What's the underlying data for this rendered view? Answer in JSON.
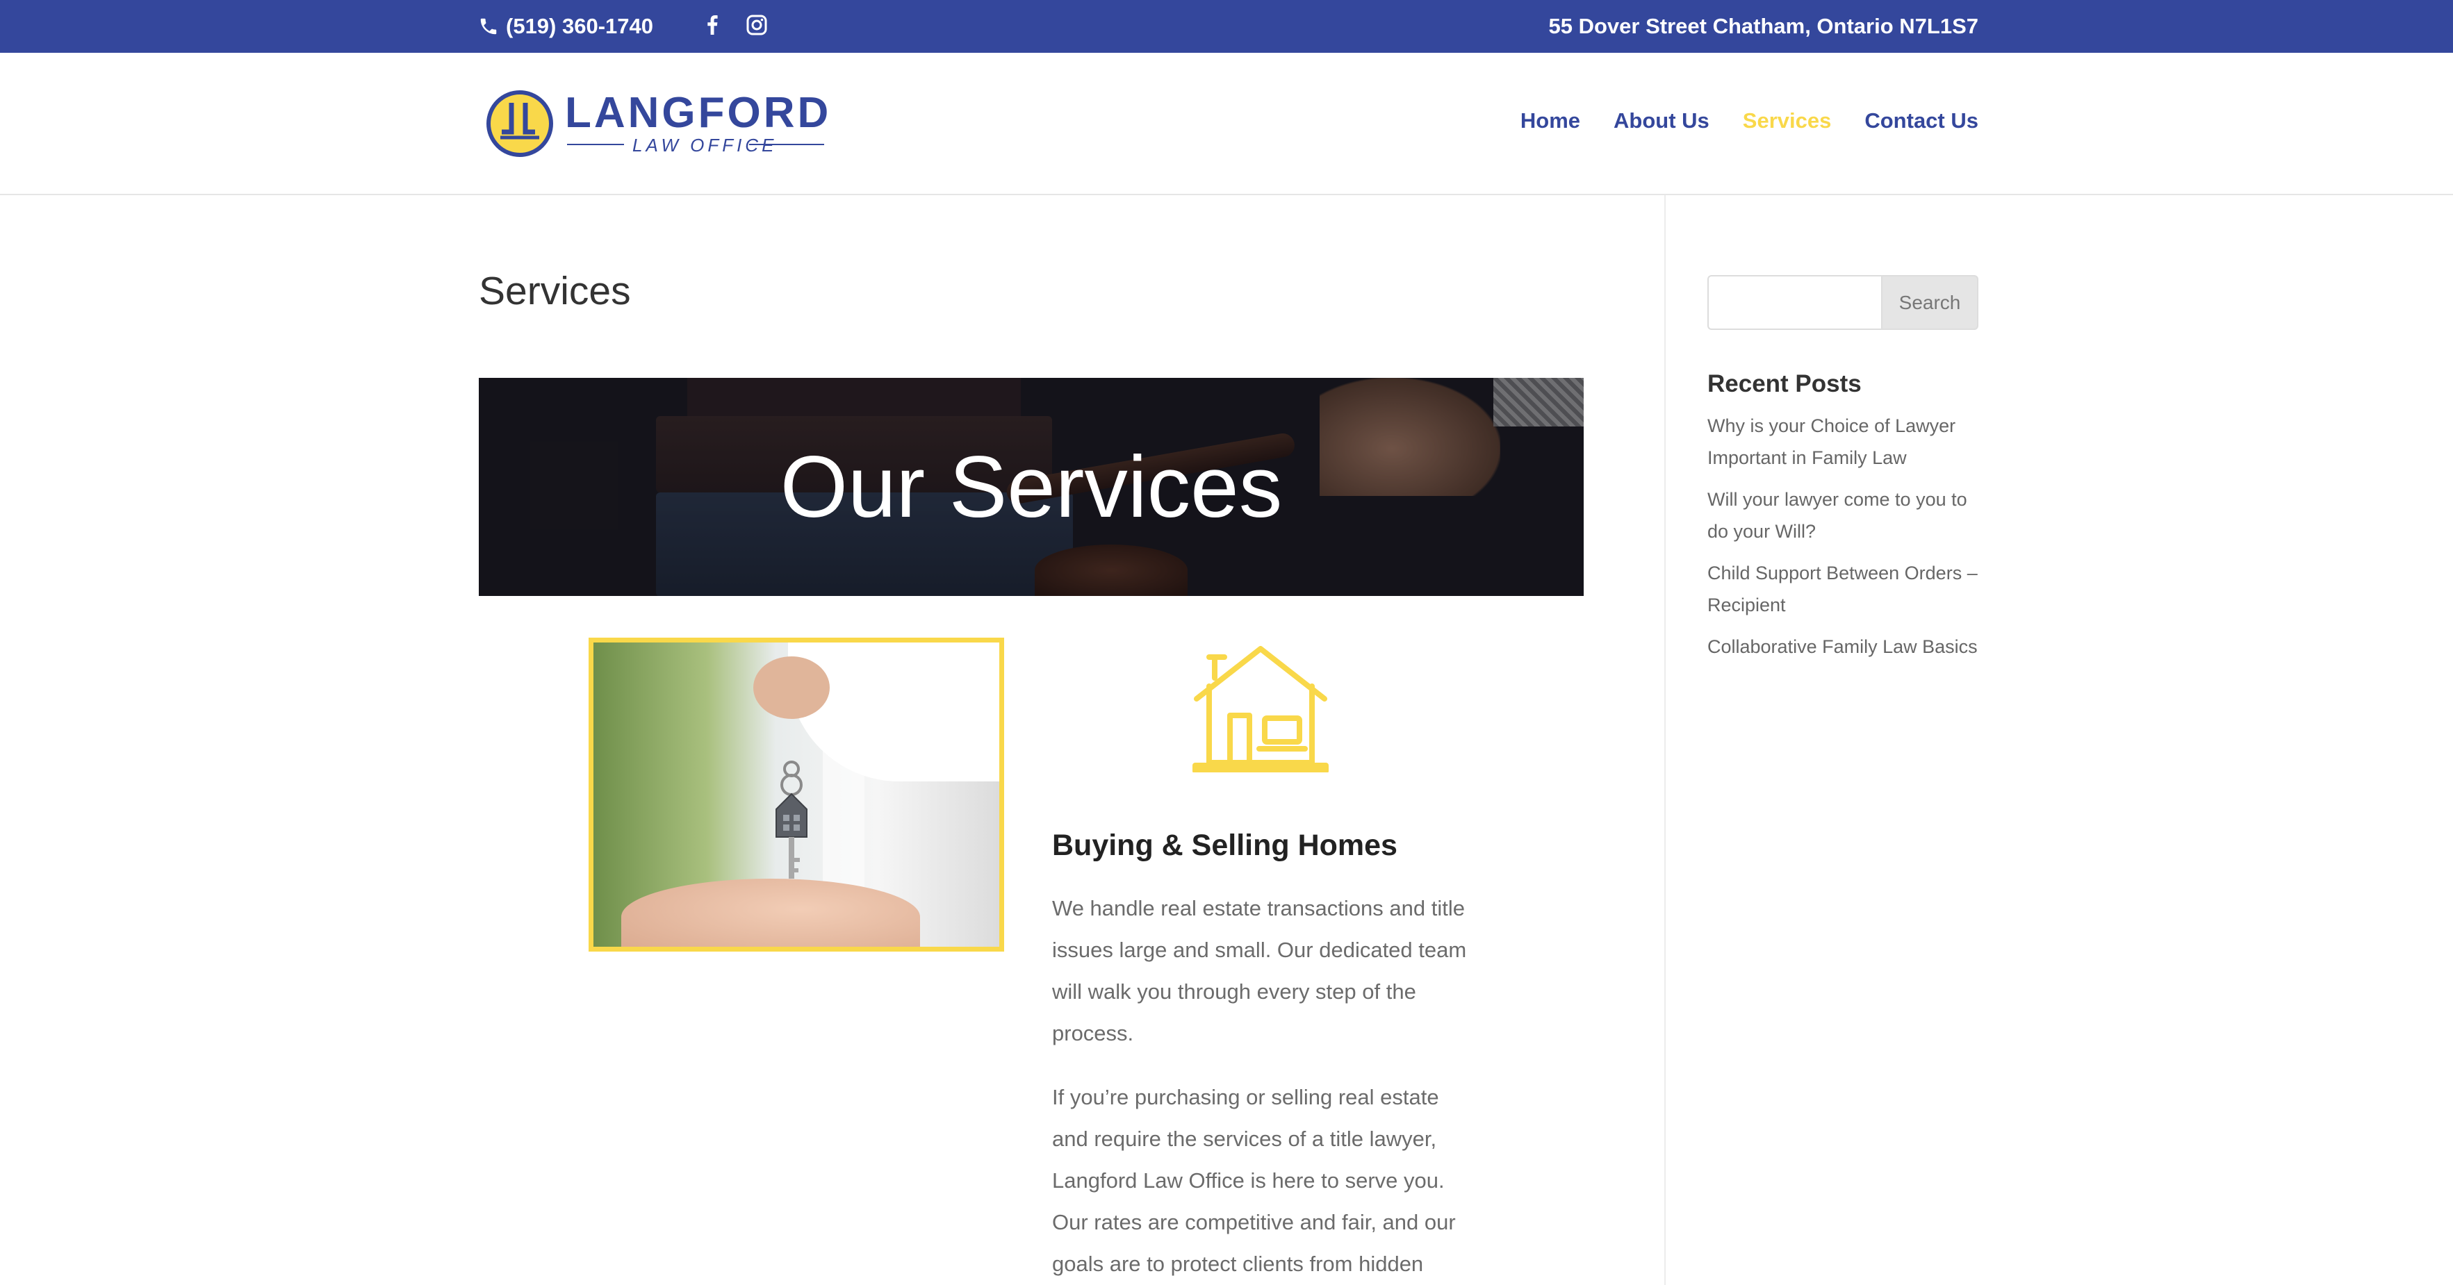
{
  "topbar": {
    "phone": "(519) 360-1740",
    "address": "55 Dover Street Chatham, Ontario N7L1S7",
    "social_icons": [
      "facebook-icon",
      "instagram-icon"
    ],
    "background": "#34479c"
  },
  "header": {
    "logo": {
      "name": "LANGFORD",
      "subtitle": "LAW OFFICE"
    },
    "nav": [
      {
        "label": "Home",
        "active": false
      },
      {
        "label": "About Us",
        "active": false
      },
      {
        "label": "Services",
        "active": true
      },
      {
        "label": "Contact Us",
        "active": false
      }
    ]
  },
  "main": {
    "page_title": "Services",
    "hero_text": "Our Services",
    "service": {
      "title": "Buying & Selling Homes",
      "paragraph1": "We handle real estate transactions and title issues large and small. Our dedicated team will walk you through every step of the process.",
      "paragraph2": "If you’re purchasing or selling real estate and require the services of a title lawyer, Langford Law Office is here to serve you. Our rates are competitive and fair, and our goals are to protect clients from hidden"
    }
  },
  "sidebar": {
    "search": {
      "value": "",
      "placeholder": "",
      "button_label": "Search"
    },
    "recent_posts_title": "Recent Posts",
    "recent_posts": [
      "Why is your Choice of Lawyer Important in Family Law",
      "Will your lawyer come to you to do your Will?",
      "Child Support Between Orders – Recipient",
      "Collaborative Family Law Basics"
    ]
  },
  "colors": {
    "brand_blue": "#34479c",
    "accent_yellow": "#f9d84a"
  }
}
